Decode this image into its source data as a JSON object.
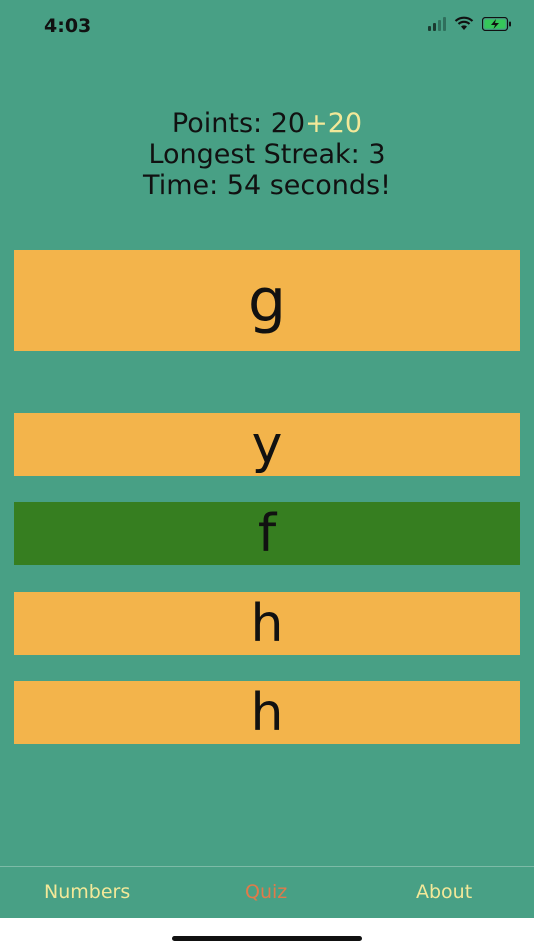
{
  "status": {
    "time": "4:03",
    "battery_color": "#35c759"
  },
  "stats": {
    "points_label": "Points: ",
    "points_value": "20",
    "points_bonus": "+20",
    "streak": "Longest Streak: 3",
    "time": "Time: 54 seconds!"
  },
  "question": {
    "glyph": "ց"
  },
  "answers": [
    {
      "label": "y",
      "state": "default"
    },
    {
      "label": "f",
      "state": "correct"
    },
    {
      "label": "h",
      "state": "default"
    },
    {
      "label": "h",
      "state": "default"
    }
  ],
  "tabs": [
    {
      "label": "Numbers",
      "active": false
    },
    {
      "label": "Quiz",
      "active": true
    },
    {
      "label": "About",
      "active": false
    }
  ],
  "colors": {
    "background": "#48a085",
    "card": "#f3b44b",
    "correct": "#367e20",
    "tab_text": "#f3e899",
    "tab_active": "#e07a4a"
  }
}
